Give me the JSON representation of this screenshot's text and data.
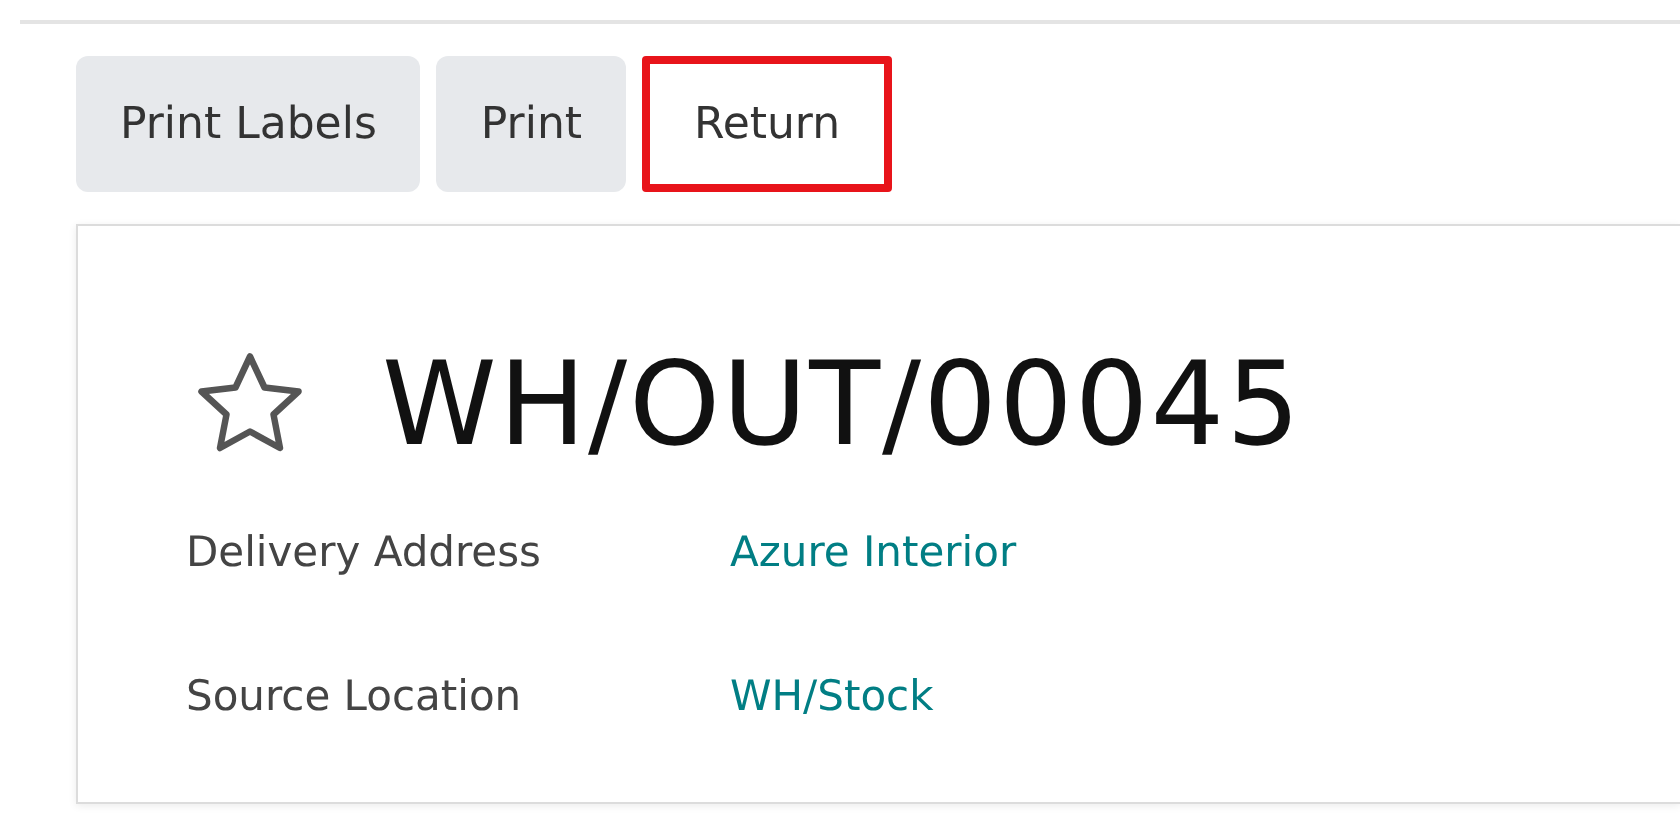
{
  "buttons": [
    {
      "label": "Print Labels",
      "highlighted": false
    },
    {
      "label": "Print",
      "highlighted": false
    },
    {
      "label": "Return",
      "highlighted": true
    }
  ],
  "record": {
    "starred": false,
    "title": "WH/OUT/00045",
    "fields": [
      {
        "label": "Delivery Address",
        "value": "Azure Interior"
      },
      {
        "label": "Source Location",
        "value": "WH/Stock"
      }
    ]
  }
}
